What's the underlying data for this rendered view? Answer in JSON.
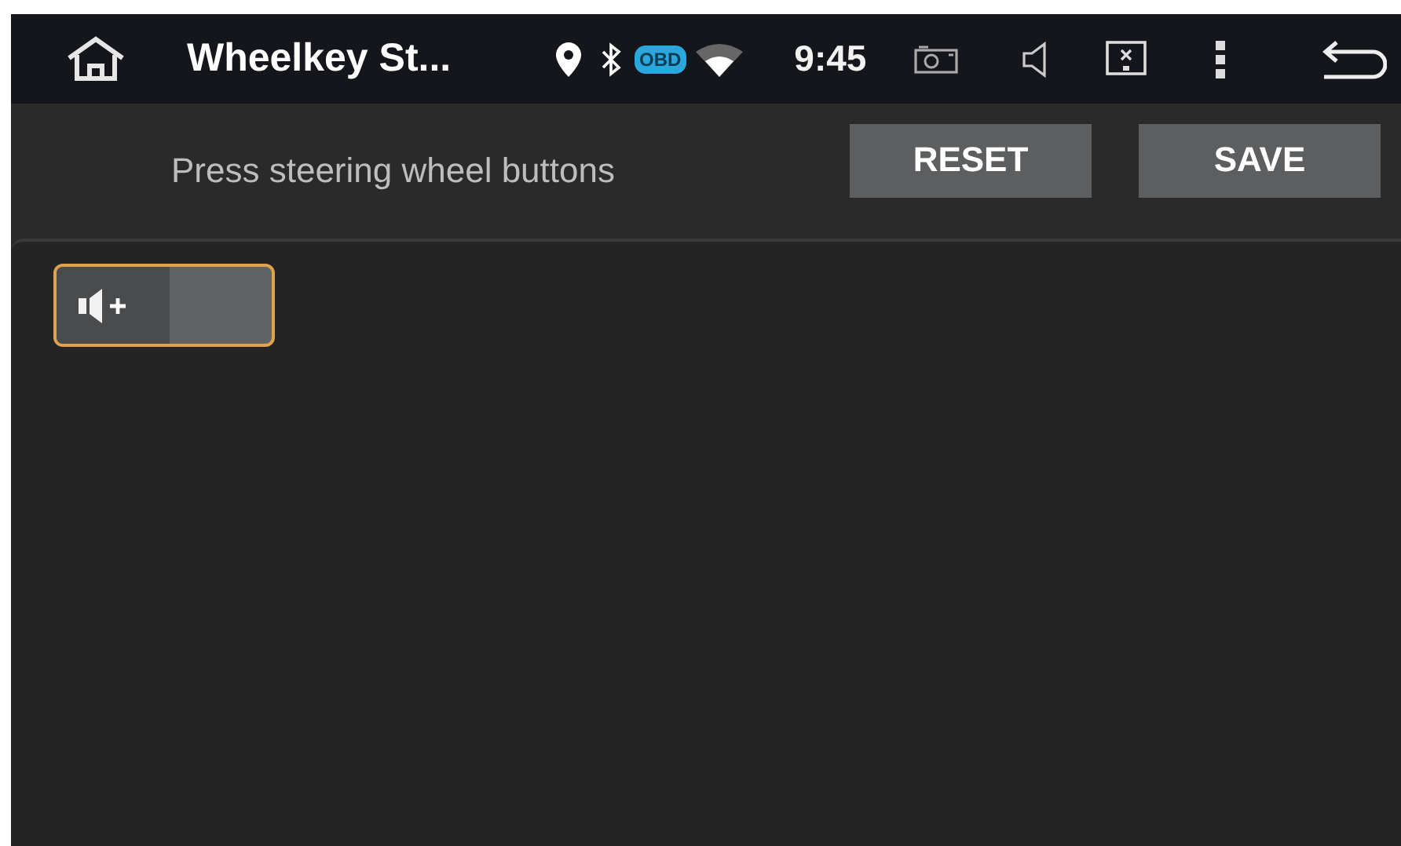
{
  "status_bar": {
    "title": "Wheelkey St...",
    "obd_badge": "OBD",
    "time": "9:45"
  },
  "header": {
    "instruction": "Press steering wheel buttons",
    "buttons": [
      "RESET",
      "SAVE"
    ]
  },
  "keys": [
    {
      "kind": "volume-up",
      "selected": true
    }
  ]
}
